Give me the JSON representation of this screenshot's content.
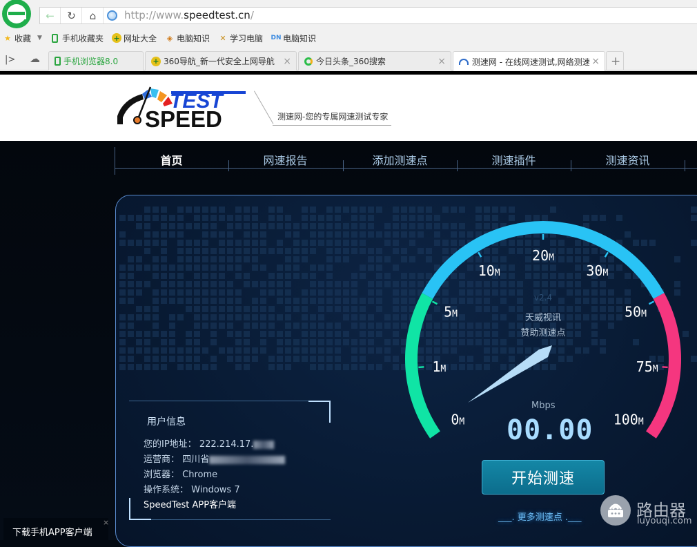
{
  "browser": {
    "url_prefix": "http://www.",
    "url_domain": "speedtest.cn",
    "url_suffix": "/",
    "bookmarks": [
      {
        "label": "收藏",
        "icon": "star-icon"
      },
      {
        "label": "手机收藏夹",
        "icon": "phone-icon"
      },
      {
        "label": "网址大全",
        "icon": "360-nav-icon"
      },
      {
        "label": "电脑知识",
        "icon": "layers-icon"
      },
      {
        "label": "学习电脑",
        "icon": "tools-icon"
      },
      {
        "label": "电脑知识",
        "icon": "dn-icon"
      }
    ],
    "tabs": [
      {
        "label": "手机浏览器8.0",
        "active": false,
        "closable": false
      },
      {
        "label": "360导航_新一代安全上网导航",
        "active": false,
        "closable": true
      },
      {
        "label": "今日头条_360搜索",
        "active": false,
        "closable": true
      },
      {
        "label": "测速网 - 在线网速测试,网络测速",
        "active": true,
        "closable": true
      }
    ],
    "new_tab": "+",
    "close_glyph": "×"
  },
  "site": {
    "logo_top": "TEST",
    "logo_bottom": "SPEED",
    "slogan": "测速网-您的专属网速测试专家",
    "nav": [
      {
        "label": "首页",
        "active": true
      },
      {
        "label": "网速报告",
        "active": false
      },
      {
        "label": "添加测速点",
        "active": false
      },
      {
        "label": "测速插件",
        "active": false
      },
      {
        "label": "测速资讯",
        "active": false
      }
    ]
  },
  "gauge": {
    "version": "v2.4",
    "sponsor_line1": "天威视讯",
    "sponsor_line2": "赞助测速点",
    "unit": "Mbps",
    "reading": "00.00",
    "value": 0,
    "ticks": [
      {
        "value": "0",
        "unit": "M"
      },
      {
        "value": "1",
        "unit": "M"
      },
      {
        "value": "5",
        "unit": "M"
      },
      {
        "value": "10",
        "unit": "M"
      },
      {
        "value": "20",
        "unit": "M"
      },
      {
        "value": "30",
        "unit": "M"
      },
      {
        "value": "50",
        "unit": "M"
      },
      {
        "value": "75",
        "unit": "M"
      },
      {
        "value": "100",
        "unit": "M"
      }
    ],
    "colors": {
      "low": "#10e4a5",
      "mid": "#29c3f5",
      "high": "#f5367f",
      "needle": "#b6dcf7"
    },
    "start_button": "开始测速",
    "more_link": "___. 更多测速点 .___"
  },
  "user_info": {
    "title": "用户信息",
    "ip_label": "您的IP地址：",
    "ip_value": "222.214.17.",
    "isp_label": "运营商：",
    "isp_value": "四川省",
    "browser_label": "浏览器：",
    "browser_value": "Chrome",
    "os_label": "操作系统：",
    "os_value": "Windows 7",
    "app_link": "SpeedTest APP客户端"
  },
  "download_bar": {
    "label": "下载手机APP客户端",
    "close": "×"
  },
  "watermark": {
    "title": "路由器",
    "domain": "luyouqi.com"
  }
}
